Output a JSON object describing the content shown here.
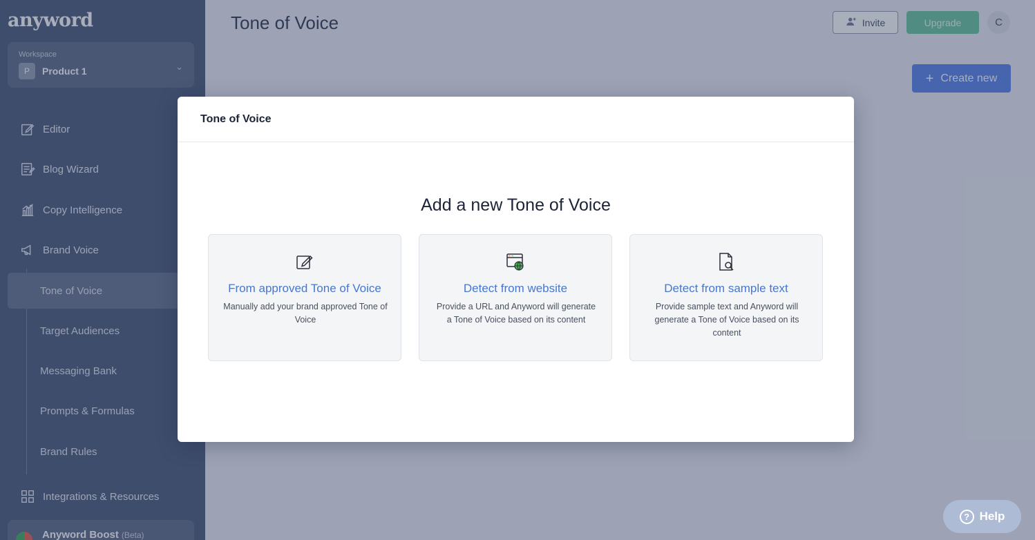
{
  "app": {
    "logo": "anyword",
    "page_title": "Tone of Voice"
  },
  "workspace": {
    "label": "Workspace",
    "badge": "P",
    "name": "Product 1"
  },
  "sidebar": {
    "items": [
      {
        "label": "Editor",
        "icon": "edit-icon"
      },
      {
        "label": "Blog Wizard",
        "icon": "document-icon"
      },
      {
        "label": "Copy Intelligence",
        "icon": "chart-icon"
      },
      {
        "label": "Brand Voice",
        "icon": "megaphone-icon"
      }
    ],
    "sub_items": [
      {
        "label": "Tone of Voice",
        "active": true
      },
      {
        "label": "Target Audiences"
      },
      {
        "label": "Messaging Bank"
      },
      {
        "label": "Prompts & Formulas"
      },
      {
        "label": "Brand Rules"
      }
    ],
    "integrations_label": "Integrations & Resources",
    "boost_label": "Anyword Boost",
    "boost_badge": "(Beta)"
  },
  "header": {
    "invite_label": "Invite",
    "upgrade_label": "Upgrade",
    "avatar_initial": "C",
    "create_new_label": "Create new"
  },
  "help": {
    "label": "Help",
    "icon_glyph": "?"
  },
  "modal": {
    "title": "Tone of Voice",
    "heading": "Add a new Tone of Voice",
    "options": [
      {
        "title": "From approved Tone of Voice",
        "description": "Manually add your brand approved Tone of Voice",
        "icon": "edit-note-icon"
      },
      {
        "title": "Detect from website",
        "description": "Provide a URL and Anyword will generate a Tone of Voice based on its content",
        "icon": "website-globe-icon"
      },
      {
        "title": "Detect from sample text",
        "description": "Provide sample text and Anyword will generate a Tone of Voice based on its content",
        "icon": "document-search-icon"
      }
    ]
  },
  "colors": {
    "sidebar_bg": "#3f4f72",
    "accent_blue": "#4e7be8",
    "upgrade_green": "#5fc29a",
    "option_title": "#4577d2"
  }
}
